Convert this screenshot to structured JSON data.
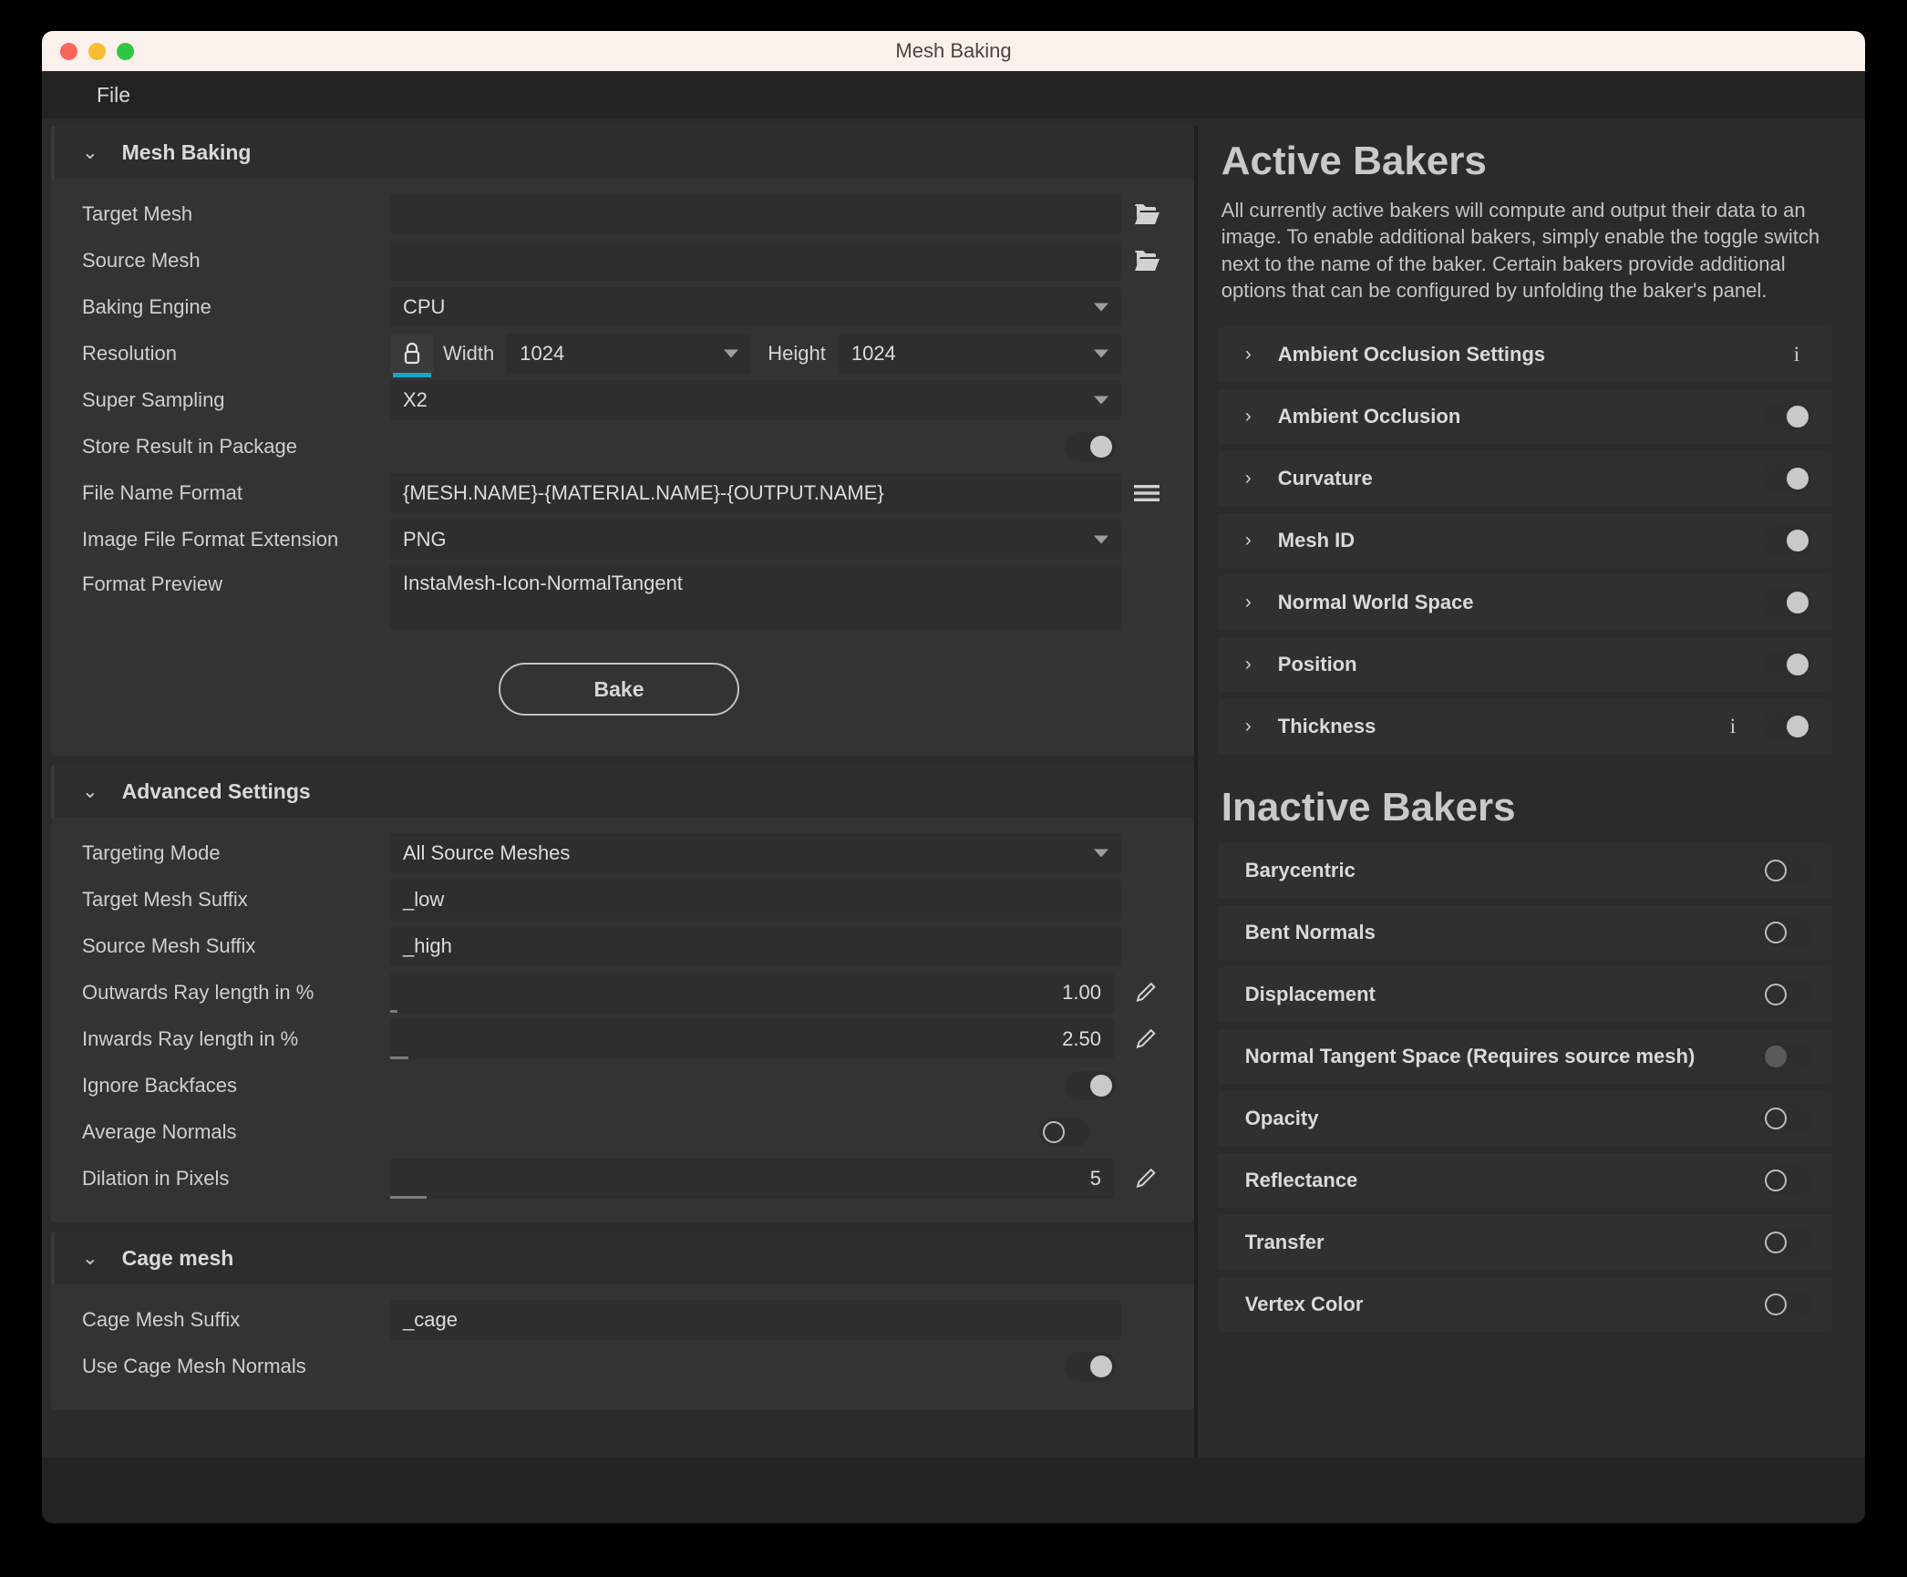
{
  "window": {
    "title": "Mesh Baking",
    "menu": [
      "File"
    ]
  },
  "mesh_baking": {
    "section_title": "Mesh Baking",
    "chevron": "⌄",
    "rows": {
      "target_mesh": {
        "label": "Target Mesh",
        "value": "",
        "icon": "folder-open-icon"
      },
      "source_mesh": {
        "label": "Source Mesh",
        "value": "",
        "icon": "folder-open-icon"
      },
      "baking_engine": {
        "label": "Baking Engine",
        "value": "CPU"
      },
      "resolution": {
        "label": "Resolution",
        "lock_icon": "lock-icon",
        "width_label": "Width",
        "width_value": "1024",
        "height_label": "Height",
        "height_value": "1024"
      },
      "super_sampling": {
        "label": "Super Sampling",
        "value": "X2"
      },
      "store_result": {
        "label": "Store Result in Package",
        "toggle": "on"
      },
      "file_name_format": {
        "label": "File Name Format",
        "value": "{MESH.NAME}-{MATERIAL.NAME}-{OUTPUT.NAME}",
        "icon": "hamburger-menu-icon"
      },
      "image_file_format": {
        "label": "Image File Format Extension",
        "value": "PNG"
      },
      "format_preview": {
        "label": "Format Preview",
        "value": "InstaMesh-Icon-NormalTangent"
      }
    },
    "bake_button": "Bake"
  },
  "advanced_settings": {
    "section_title": "Advanced Settings",
    "rows": {
      "targeting_mode": {
        "label": "Targeting Mode",
        "value": "All Source Meshes"
      },
      "target_mesh_suffix": {
        "label": "Target Mesh Suffix",
        "value": "_low"
      },
      "source_mesh_suffix": {
        "label": "Source Mesh Suffix",
        "value": "_high"
      },
      "outwards_ray": {
        "label": "Outwards Ray length in %",
        "value": "1.00",
        "fill_pct": 1
      },
      "inwards_ray": {
        "label": "Inwards Ray length in %",
        "value": "2.50",
        "fill_pct": 2.5
      },
      "ignore_backfaces": {
        "label": "Ignore Backfaces",
        "toggle": "on"
      },
      "average_normals": {
        "label": "Average Normals",
        "toggle": "off"
      },
      "dilation_pixels": {
        "label": "Dilation in Pixels",
        "value": "5",
        "fill_pct": 5
      }
    }
  },
  "cage_mesh": {
    "section_title": "Cage mesh",
    "rows": {
      "cage_mesh_suffix": {
        "label": "Cage Mesh Suffix",
        "value": "_cage"
      },
      "use_cage_mesh_normals": {
        "label": "Use Cage Mesh Normals",
        "toggle": "on"
      }
    }
  },
  "active_bakers": {
    "title": "Active Bakers",
    "description": "All currently active bakers will compute and output their data to an image. To enable additional bakers, simply enable the toggle switch next to the name of the baker. Certain bakers provide additional options that can be configured by unfolding the baker's panel.",
    "items": [
      {
        "label": "Ambient Occlusion Settings",
        "chevron": "›",
        "info": true,
        "toggle": null
      },
      {
        "label": "Ambient Occlusion",
        "chevron": "›",
        "info": false,
        "toggle": "on"
      },
      {
        "label": "Curvature",
        "chevron": "›",
        "info": false,
        "toggle": "on"
      },
      {
        "label": "Mesh ID",
        "chevron": "›",
        "info": false,
        "toggle": "on"
      },
      {
        "label": "Normal World Space",
        "chevron": "›",
        "info": false,
        "toggle": "on"
      },
      {
        "label": "Position",
        "chevron": "›",
        "info": false,
        "toggle": "on"
      },
      {
        "label": "Thickness",
        "chevron": "›",
        "info": true,
        "toggle": "on"
      }
    ]
  },
  "inactive_bakers": {
    "title": "Inactive Bakers",
    "items": [
      {
        "label": "Barycentric",
        "toggle": "off"
      },
      {
        "label": "Bent Normals",
        "toggle": "off"
      },
      {
        "label": "Displacement",
        "toggle": "off"
      },
      {
        "label": "Normal Tangent Space (Requires source mesh)",
        "toggle": "disabled"
      },
      {
        "label": "Opacity",
        "toggle": "off"
      },
      {
        "label": "Reflectance",
        "toggle": "off"
      },
      {
        "label": "Transfer",
        "toggle": "off"
      },
      {
        "label": "Vertex Color",
        "toggle": "off"
      }
    ]
  },
  "colors": {
    "accent": "#1ba3c4",
    "window_bg": "#2b2b2b",
    "card_bg": "#333333",
    "field_bg": "#2e2e2e",
    "titlebar_bg": "#faf1ec"
  }
}
